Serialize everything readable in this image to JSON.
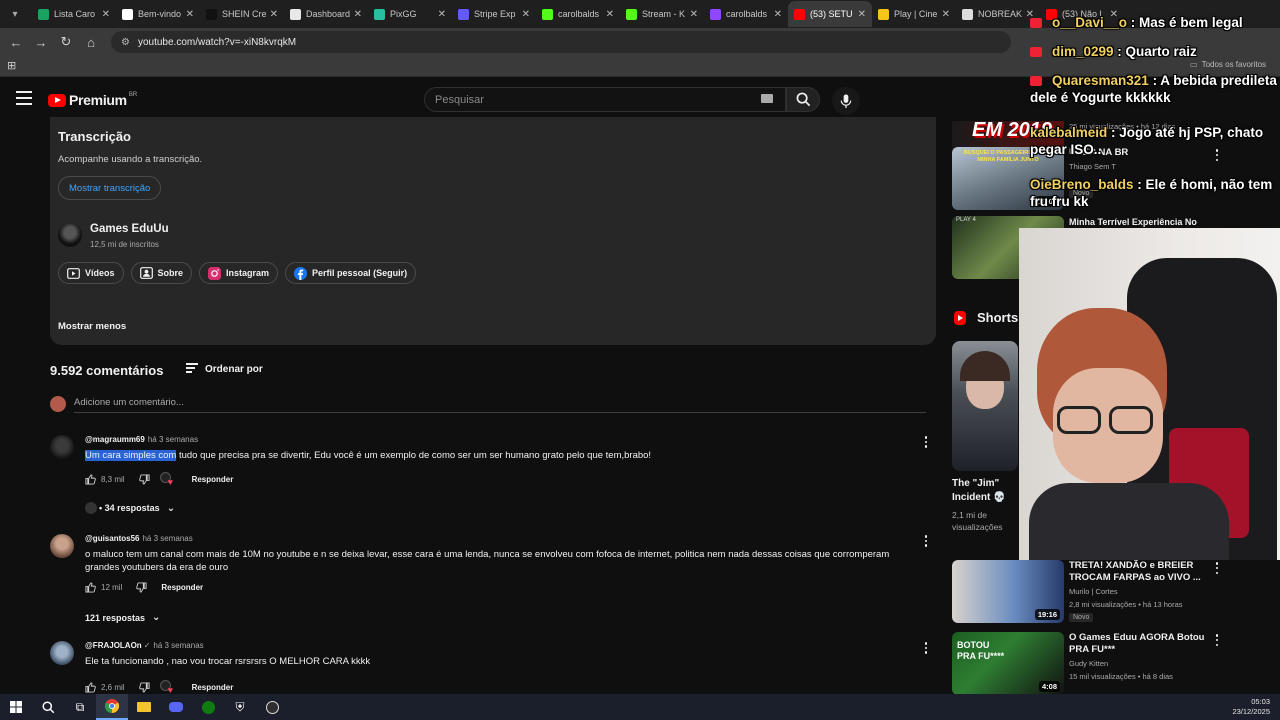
{
  "browser": {
    "tabs": [
      {
        "label": "Lista Caro",
        "color": "#1aa260"
      },
      {
        "label": "Bem-vindo",
        "color": "#ffffff"
      },
      {
        "label": "SHEIN Cre",
        "color": "#111111"
      },
      {
        "label": "Dashboard",
        "color": "#e8e8e8"
      },
      {
        "label": "PixGG",
        "color": "#28c0a0"
      },
      {
        "label": "Stripe Exp",
        "color": "#635bff"
      },
      {
        "label": "carolbalds",
        "color": "#53fc18"
      },
      {
        "label": "Stream - K",
        "color": "#53fc18"
      },
      {
        "label": "carolbalds",
        "color": "#9146ff"
      },
      {
        "label": "(53) SETU",
        "color": "#ff0000"
      },
      {
        "label": "Play | Cine",
        "color": "#f5c518"
      },
      {
        "label": "NOBREAK",
        "color": "#dddddd"
      },
      {
        "label": "(53) Não l",
        "color": "#ff0000"
      }
    ],
    "url": "youtube.com/watch?v=-xiN8kvrqkM",
    "all_favorites": "Todos os favoritos"
  },
  "yt": {
    "logo_text": "Premium",
    "region": "BR",
    "search_placeholder": "Pesquisar"
  },
  "description": {
    "title": "Transcrição",
    "subtitle": "Acompanhe usando a transcrição.",
    "show_transcript": "Mostrar transcrição",
    "channel_name": "Games EduUu",
    "channel_subs": "12,5 mi de inscritos",
    "links": [
      "Vídeos",
      "Sobre",
      "Instagram",
      "Perfil pessoal (Seguir)"
    ],
    "show_less": "Mostrar menos"
  },
  "comments": {
    "count_label": "9.592 comentários",
    "sort_label": "Ordenar por",
    "add_placeholder": "Adicione um comentário...",
    "reply_label": "Responder",
    "items": [
      {
        "author": "@magraumm69",
        "time": "há 3 semanas",
        "text_selected": "Um cara simples com",
        "text_rest": " tudo que precisa pra se divertir, Edu você é um exemplo de como ser um ser humano grato pelo que tem,brabo!",
        "likes": "8,3 mil",
        "replies": "• 34 respostas"
      },
      {
        "author": "@guisantos56",
        "time": "há 3 semanas",
        "text": "o maluco tem um canal com mais de 10M no youtube e n se deixa levar, esse cara é uma lenda, nunca se envolveu com fofoca de internet, politica nem nada dessas coisas que corromperam grandes youtubers da era de ouro",
        "likes": "12 mil",
        "replies": "121 respostas"
      },
      {
        "author": "@FRAJOLAOn",
        "time": "há 3 semanas",
        "text": "Ele ta funcionando , nao vou trocar rsrsrsrs O MELHOR CARA kkkk",
        "likes": "2,6 mil"
      }
    ]
  },
  "sidebar": {
    "videos": [
      {
        "views": "25 mi visualizações • há 12 dias",
        "thumb_text": "EM 2019"
      },
      {
        "title": "UBER NA BR",
        "channel": "Thiago Sem T",
        "badge": "Novo",
        "duration": "16:07",
        "thumb_text": "BUSQUEI O PASSAGEIRO COM A MINHA FAMÍLIA JUNTO"
      },
      {
        "title": "Minha Terrível Experiência No",
        "thumb_text": "PLAY 4"
      }
    ],
    "shorts_label": "Shorts",
    "short": {
      "title": "The \"Jim\" Incident 💀",
      "views": "2,1 mi de visualizações"
    },
    "bottom_videos": [
      {
        "title": "TRETA! XANDÃO e BREIER TROCAM FARPAS ao VIVO ...",
        "channel": "Murilo | Cortes",
        "views": "2,8 mi visualizações • há 13 horas",
        "badge": "Novo",
        "duration": "19:16"
      },
      {
        "title": "O Games Eduu AGORA Botou PRA FU***",
        "channel": "Gudy Kitten",
        "views": "15 mil visualizações • há 8 dias",
        "duration": "4:08",
        "thumb_text": "BOTOU PRA FU****"
      }
    ]
  },
  "chat": [
    {
      "name": "o__Davi__o",
      "msg": " : Mas é bem legal"
    },
    {
      "name": "dim_0299",
      "msg": " : Quarto raiz"
    },
    {
      "name": "Quaresman321",
      "msg": " : A bebida predileta dele é Yogurte kkkkkk"
    },
    {
      "name": "kalebalmeid",
      "msg": " : Jogo até hj PSP, chato pegar ISO.."
    },
    {
      "name": "OieBreno_balds",
      "msg": " : Ele é homi, não tem fru fru kk"
    }
  ],
  "tray": {
    "time": "05:03",
    "date": "23/12/2025"
  }
}
